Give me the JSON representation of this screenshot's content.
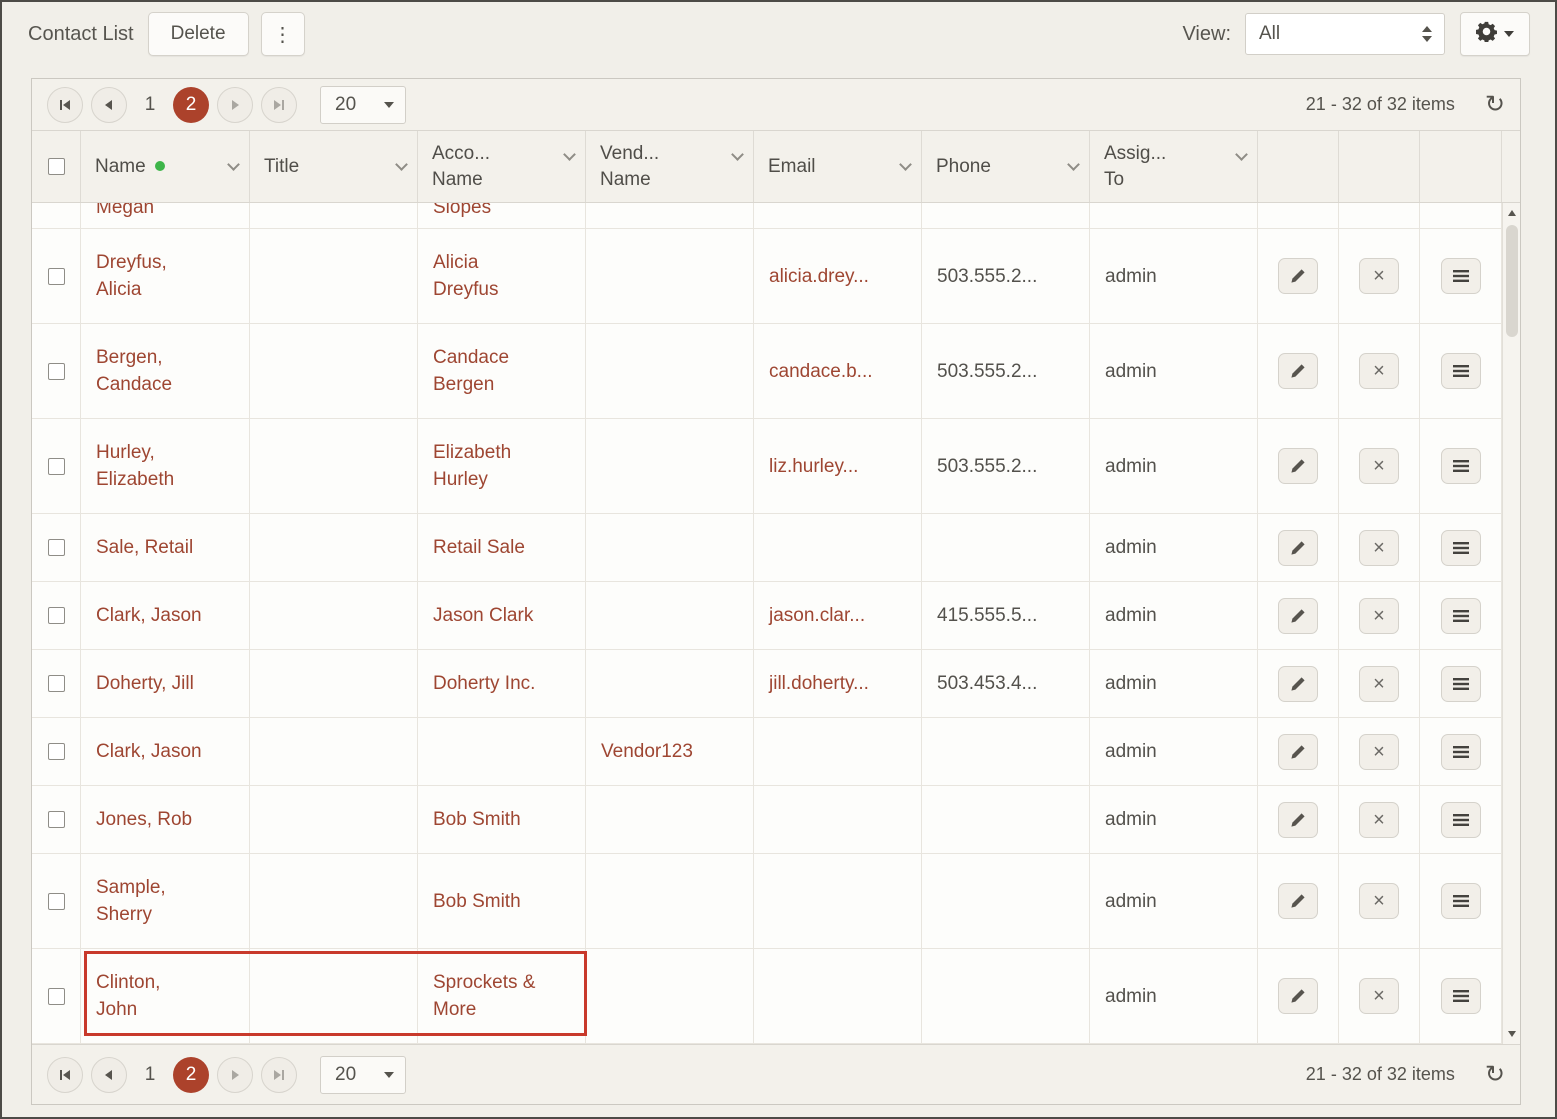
{
  "toolbar": {
    "title": "Contact List",
    "delete_label": "Delete",
    "view_label": "View:",
    "view_value": "All"
  },
  "pager": {
    "page_1": "1",
    "page_2": "2",
    "page_size": "20",
    "info": "21 - 32 of 32 items"
  },
  "columns": {
    "name": "Name",
    "title": "Title",
    "account_l1": "Acco...",
    "account_l2": "Name",
    "vendor_l1": "Vend...",
    "vendor_l2": "Name",
    "email": "Email",
    "phone": "Phone",
    "assigned_l1": "Assig...",
    "assigned_l2": "To"
  },
  "partial_row": {
    "name": "Megan",
    "account": "Slopes"
  },
  "rows": [
    {
      "name": "Dreyfus,\nAlicia",
      "title": "",
      "account": "Alicia\nDreyfus",
      "vendor": "",
      "email": "alicia.drey...",
      "phone": "503.555.2...",
      "assigned": "admin"
    },
    {
      "name": "Bergen,\nCandace",
      "title": "",
      "account": "Candace\nBergen",
      "vendor": "",
      "email": "candace.b...",
      "phone": "503.555.2...",
      "assigned": "admin"
    },
    {
      "name": "Hurley,\nElizabeth",
      "title": "",
      "account": "Elizabeth\nHurley",
      "vendor": "",
      "email": "liz.hurley...",
      "phone": "503.555.2...",
      "assigned": "admin"
    },
    {
      "name": "Sale, Retail",
      "title": "",
      "account": "Retail Sale",
      "vendor": "",
      "email": "",
      "phone": "",
      "assigned": "admin"
    },
    {
      "name": "Clark, Jason",
      "title": "",
      "account": "Jason Clark",
      "vendor": "",
      "email": "jason.clar...",
      "phone": "415.555.5...",
      "assigned": "admin"
    },
    {
      "name": "Doherty, Jill",
      "title": "",
      "account": "Doherty Inc.",
      "vendor": "",
      "email": "jill.doherty...",
      "phone": "503.453.4...",
      "assigned": "admin"
    },
    {
      "name": "Clark, Jason",
      "title": "",
      "account": "",
      "vendor": "Vendor123",
      "email": "",
      "phone": "",
      "assigned": "admin"
    },
    {
      "name": "Jones, Rob",
      "title": "",
      "account": "Bob Smith",
      "vendor": "",
      "email": "",
      "phone": "",
      "assigned": "admin"
    },
    {
      "name": "Sample,\nSherry",
      "title": "",
      "account": "Bob Smith",
      "vendor": "",
      "email": "",
      "phone": "",
      "assigned": "admin"
    },
    {
      "name": "Clinton,\nJohn",
      "title": "",
      "account": "Sprockets &\nMore",
      "vendor": "",
      "email": "",
      "phone": "",
      "assigned": "admin",
      "highlighted": true
    }
  ],
  "colors": {
    "accent": "#ac422b",
    "link": "#9e4632",
    "highlight": "#c8392b",
    "green_dot": "#3db549"
  }
}
